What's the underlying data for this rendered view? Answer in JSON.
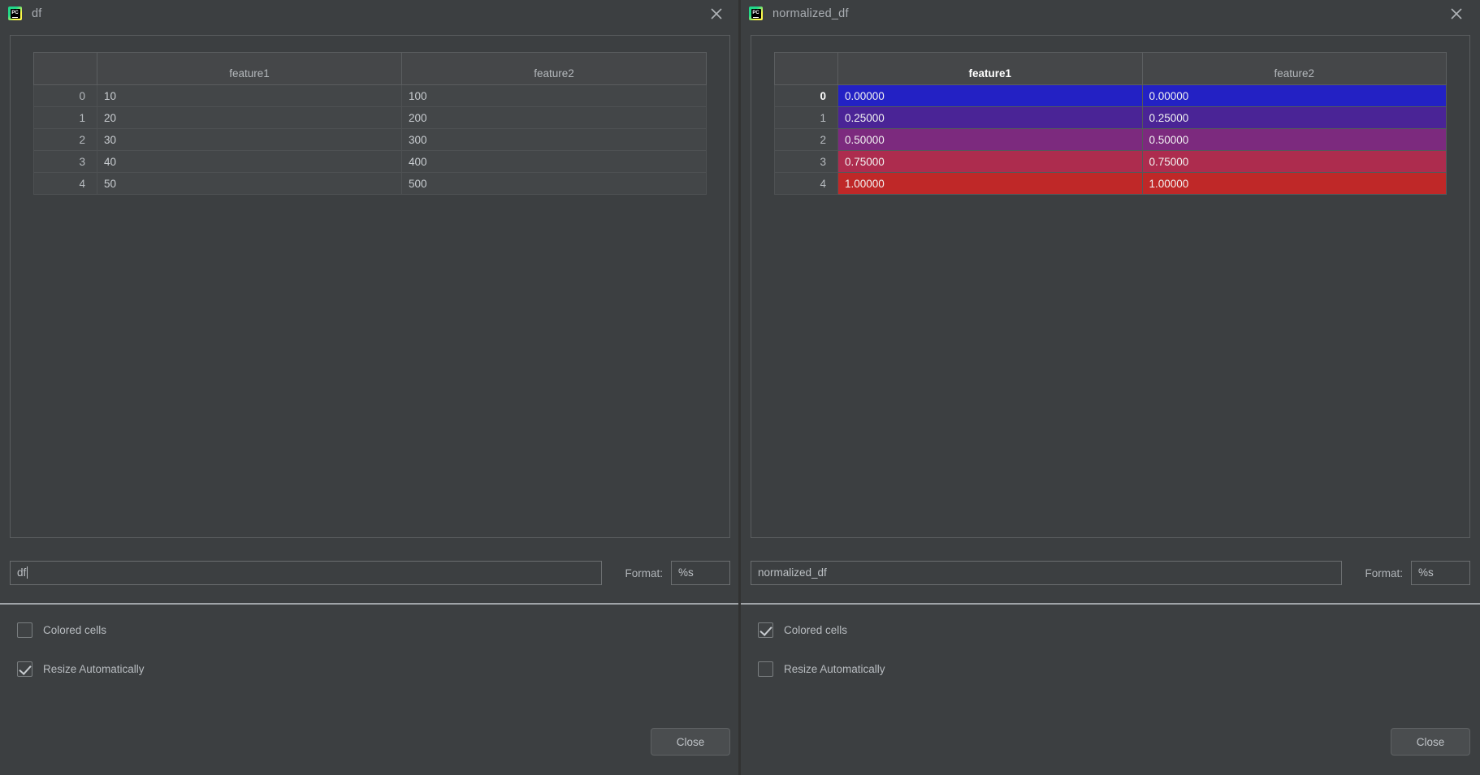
{
  "windows": [
    {
      "title": "df",
      "icon": "pycharm-icon",
      "close_icon": "close-icon",
      "table": {
        "index_header": "",
        "columns": [
          "feature1",
          "feature2"
        ],
        "selected_column": null,
        "selected_row": null,
        "rows": [
          {
            "index": "0",
            "cells": [
              "10",
              "100"
            ]
          },
          {
            "index": "1",
            "cells": [
              "20",
              "200"
            ]
          },
          {
            "index": "2",
            "cells": [
              "30",
              "300"
            ]
          },
          {
            "index": "3",
            "cells": [
              "40",
              "400"
            ]
          },
          {
            "index": "4",
            "cells": [
              "50",
              "500"
            ]
          }
        ],
        "colored": false,
        "cell_colors": []
      },
      "expression": {
        "value": "df",
        "placeholder": "Expression"
      },
      "format": {
        "label": "Format:",
        "value": "%s",
        "placeholder": "%s"
      },
      "colored_cells": {
        "label": "Colored cells",
        "checked": false
      },
      "resize_automatically": {
        "label": "Resize Automatically",
        "checked": true
      },
      "close_button": {
        "label": "Close"
      }
    },
    {
      "title": "normalized_df",
      "icon": "pycharm-icon",
      "close_icon": "close-icon",
      "table": {
        "index_header": "",
        "columns": [
          "feature1",
          "feature2"
        ],
        "selected_column": "feature1",
        "selected_row": "0",
        "rows": [
          {
            "index": "0",
            "cells": [
              "0.00000",
              "0.00000"
            ]
          },
          {
            "index": "1",
            "cells": [
              "0.25000",
              "0.25000"
            ]
          },
          {
            "index": "2",
            "cells": [
              "0.50000",
              "0.50000"
            ]
          },
          {
            "index": "3",
            "cells": [
              "0.75000",
              "0.75000"
            ]
          },
          {
            "index": "4",
            "cells": [
              "1.00000",
              "1.00000"
            ]
          }
        ],
        "colored": true,
        "cell_colors": [
          "#2321c4",
          "#4a2496",
          "#7c2a7e",
          "#ad2c4e",
          "#bf2828"
        ]
      },
      "expression": {
        "value": "normalized_df",
        "placeholder": "Expression"
      },
      "format": {
        "label": "Format:",
        "value": "%s",
        "placeholder": "%s"
      },
      "colored_cells": {
        "label": "Colored cells",
        "checked": true
      },
      "resize_automatically": {
        "label": "Resize Automatically",
        "checked": false
      },
      "close_button": {
        "label": "Close"
      }
    }
  ],
  "theme": {
    "background": "#3c3f41",
    "panel": "#434648",
    "header": "#454749",
    "text": "#b8bcc0",
    "border": "#5a5d5f"
  }
}
